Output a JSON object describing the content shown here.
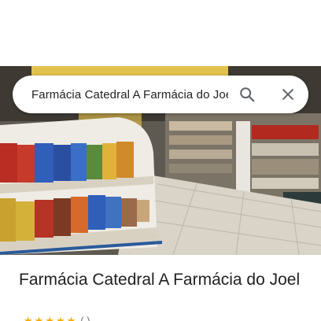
{
  "search": {
    "query": "Farmácia Catedral A Farmácia do Joel"
  },
  "place": {
    "name": "Farmácia Catedral A Farmácia do Joel",
    "rating_stars": 5,
    "review_count_text": "( )"
  },
  "icons": {
    "search": "search-icon",
    "close": "close-icon"
  },
  "colors": {
    "text_primary": "#202124",
    "icon_gray": "#5f6368",
    "star_yellow": "#f9ab00"
  }
}
